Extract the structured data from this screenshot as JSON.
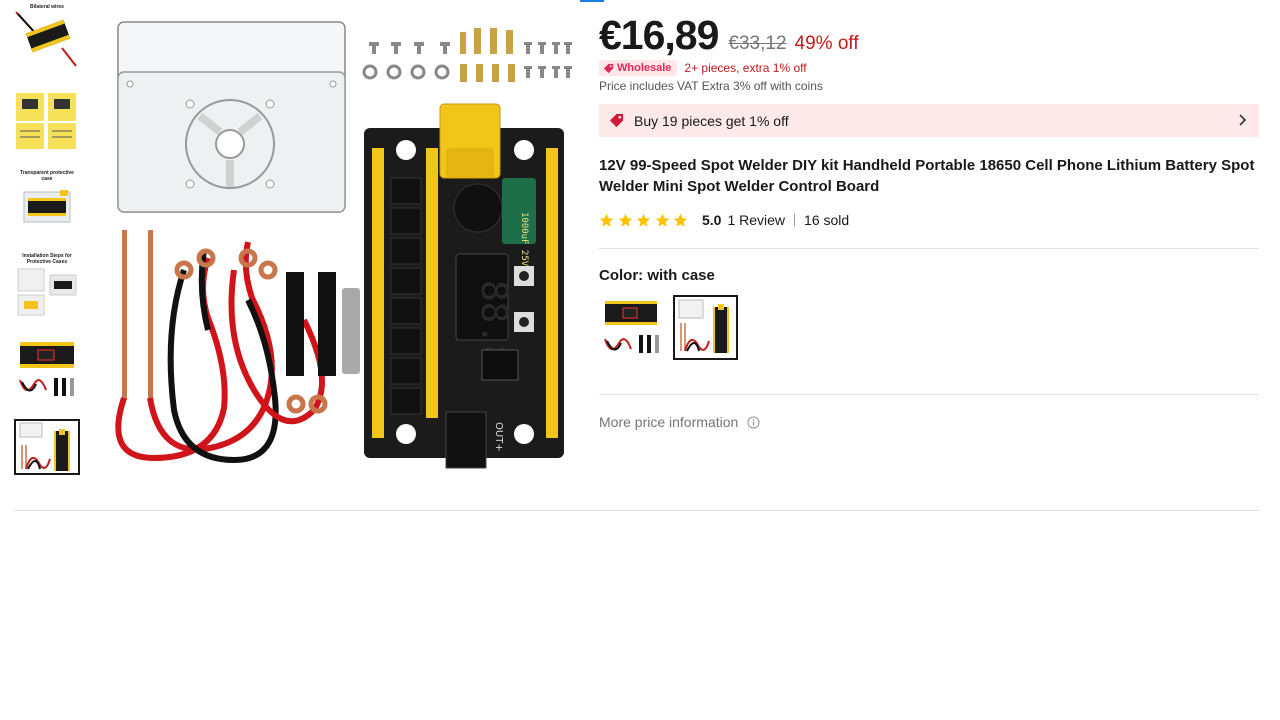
{
  "thumbnails": [
    {
      "caption": "Bilateral wires"
    },
    {
      "caption": ""
    },
    {
      "caption": "Transparent protective case"
    },
    {
      "caption": "Installation Steps for Protective Cases"
    },
    {
      "caption": ""
    },
    {
      "caption": ""
    }
  ],
  "main_image": {
    "pcb_display": "88.8",
    "capacitor_text": "1000uF 25V",
    "board_label": "OUT+"
  },
  "price": {
    "current": "€16,89",
    "original": "€33,12",
    "discount": "49% off"
  },
  "wholesale": {
    "badge": "Wholesale",
    "text": "2+ pieces, extra 1% off"
  },
  "vat_note": "Price includes VAT Extra 3% off with coins",
  "promo": {
    "text": "Buy 19 pieces get 1% off"
  },
  "product_title": "12V 99-Speed Spot Welder DIY kit Handheld Portable 18650 Cell Phone Lithium Battery Spot Welder Mini Spot Welder Control Board",
  "rating": {
    "stars": 5,
    "score": "5.0",
    "reviews": "1 Review",
    "sold": "16 sold"
  },
  "color": {
    "label": "Color: with case",
    "options": [
      "without case",
      "with case"
    ],
    "selected_index": 1
  },
  "more_price_info": "More price information",
  "colors": {
    "accent_red": "#c01a1a",
    "promo_bg": "#fde9ea",
    "wholesale_pink": "#e0285a",
    "star_yellow": "#fcc200",
    "pcb_yellow": "#f2c51b"
  }
}
